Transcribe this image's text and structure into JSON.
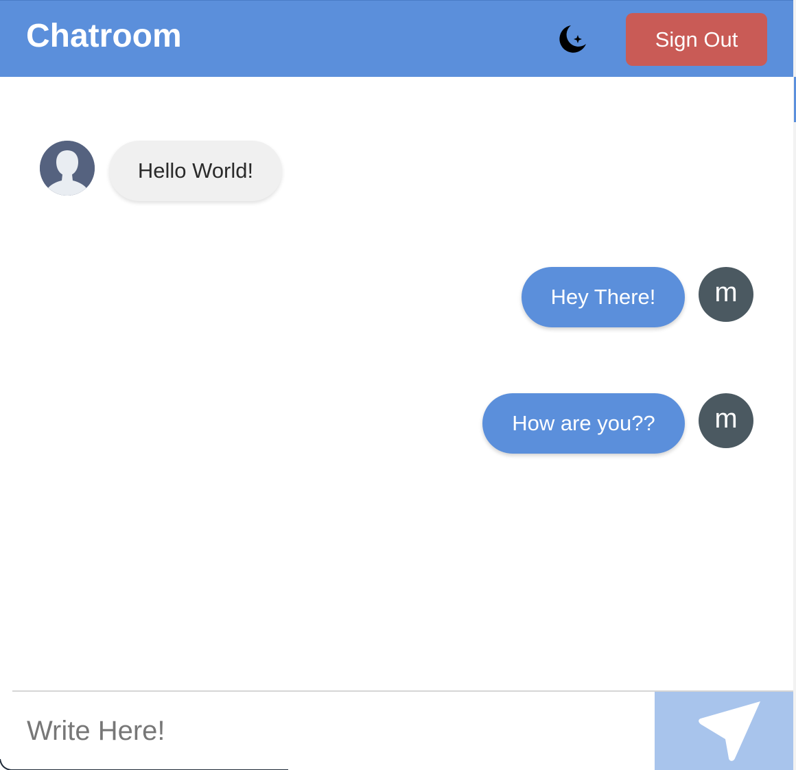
{
  "header": {
    "title": "Chatroom",
    "theme_icon": "moon-star-icon",
    "sign_out_label": "Sign Out",
    "background_color": "#5b8fdb",
    "sign_out_color": "#c95b56"
  },
  "messages": [
    {
      "direction": "received",
      "text": "Hello World!",
      "avatar": "default-user-avatar"
    },
    {
      "direction": "sent",
      "text": "Hey There!",
      "avatar_letter": "m"
    },
    {
      "direction": "sent",
      "text": "How are you??",
      "avatar_letter": "m"
    }
  ],
  "composer": {
    "placeholder": "Write Here!",
    "value": "",
    "send_icon": "send-icon",
    "send_color": "#a8c4ec"
  }
}
